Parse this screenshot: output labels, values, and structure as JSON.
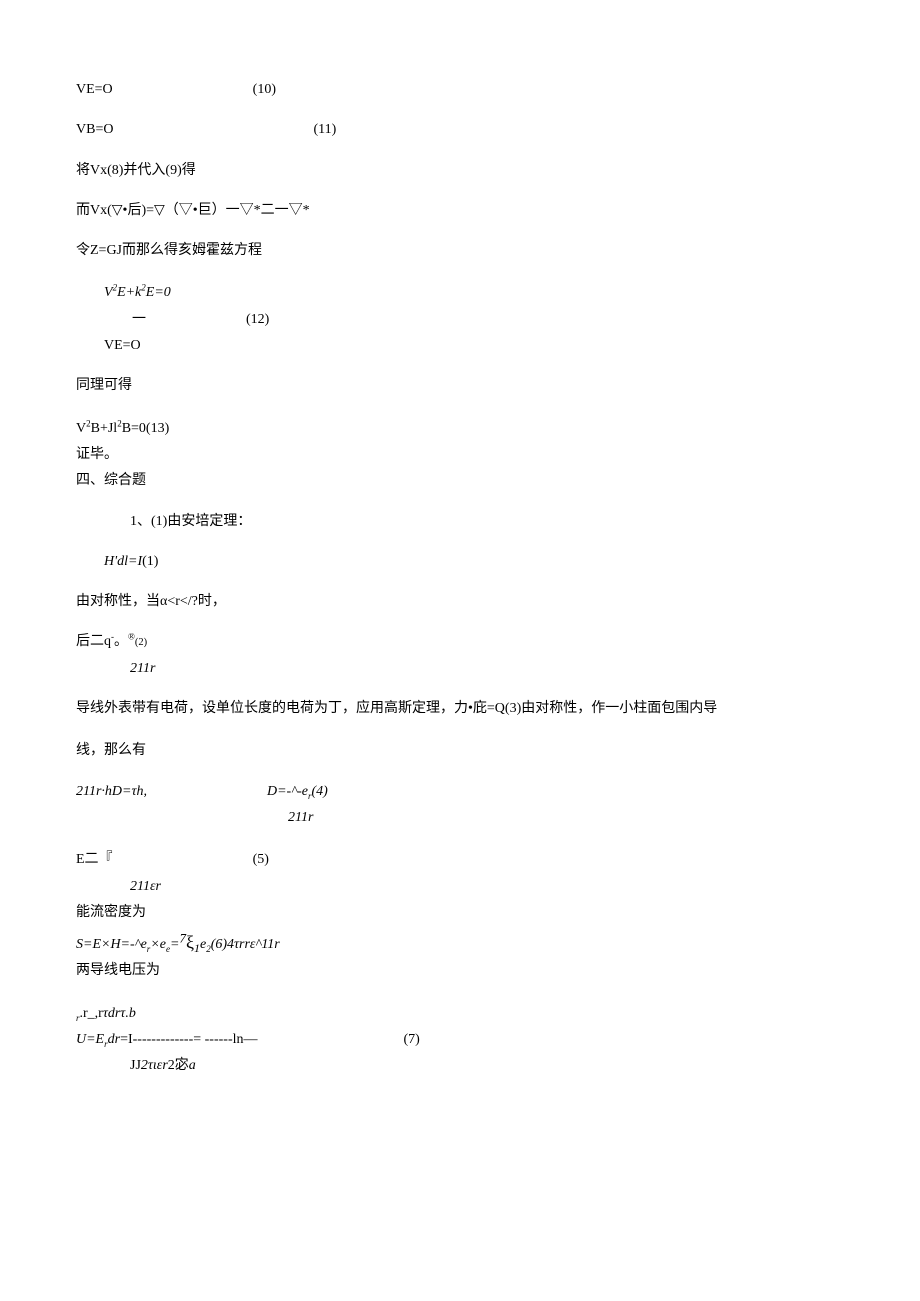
{
  "lines": {
    "l1_lhs": "VE=O",
    "l1_num": "(10)",
    "l2_lhs": "VB=O",
    "l2_num": "(11)",
    "l3": "将Vx(8)并代入(9)得",
    "l4": "而Vx(▽•后)=▽（▽•巨）一▽*二一▽*",
    "l5": "令Z=GJ而那么得亥姆霍兹方程",
    "l6a": "V",
    "l6b": "2",
    "l6c": "E+k",
    "l6d": "2",
    "l6e": "E=0",
    "l7a": "一",
    "l7b": "(12)",
    "l8": "VE=O",
    "l9": "同理可得",
    "l10a": "V",
    "l10b": "2",
    "l10c": "B+Jl",
    "l10d": "2",
    "l10e": "B=0(13)",
    "l11": "证毕。",
    "l12": "四、综合题",
    "l13": "1、(1)由安培定理：",
    "l14a": "H'dl=I",
    "l14b": "(1)",
    "l15": "由对称性，当α<r</?时，",
    "l16a": "后二q",
    "l16b": "-",
    "l16c": "。",
    "l16d": "®",
    "l16e": "(2)",
    "l17": "211r",
    "l18": "导线外表带有电荷，设单位长度的电荷为丁，应用高斯定理，力•庇=Q(3)由对称性，作一小柱面包围内导",
    "l19": "线，那么有",
    "l20a": "211r·hD=τh,",
    "l20b": "D=-^-e",
    "l20c": "r",
    "l20d": "(4)",
    "l21": "211r",
    "l22a": "E二『",
    "l22b": "(5)",
    "l23": "211εr",
    "l24": "能流密度为",
    "l25a": "S=E×H=-^e",
    "l25b": "r",
    "l25c": "×e",
    "l25d": "e",
    "l25e": "=",
    "l25f": "7",
    "l25g": "ξ",
    "l25h": "1",
    "l25i": "e",
    "l25j": "2",
    "l25k": "(6)4τrrε^11r",
    "l26": "两导线电压为",
    "l27a": "r",
    "l27b": ".r_,r",
    "l27c": "τdrτ.b",
    "l28a": "U=E",
    "l28b": "r",
    "l28c": "dr",
    "l28d": "=I",
    "l28e": "-------------",
    "l28f": "= ------",
    "l28g": "ln—",
    "l28h": "(7)",
    "l29a": "JJ",
    "l29b": "2τιεr",
    "l29c": "2宓",
    "l29d": "a"
  }
}
